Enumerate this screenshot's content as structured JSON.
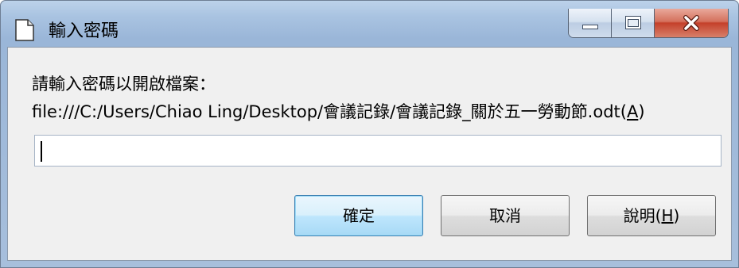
{
  "window": {
    "title": "輸入密碼",
    "icon": "document-icon",
    "controls": {
      "minimize_icon": "minimize-icon",
      "maximize_icon": "maximize-icon",
      "close_icon": "close-icon"
    }
  },
  "dialog": {
    "prompt": "請輸入密碼以開啟檔案：",
    "file_path": "file:///C:/Users/Chiao Ling/Desktop/會議記錄/會議記錄_關於五一勞動節.odt",
    "file_path_mnemonic_open": "(",
    "file_path_mnemonic_key": "A",
    "file_path_mnemonic_close": ")",
    "password_value": "",
    "password_placeholder": ""
  },
  "buttons": {
    "ok_label": "確定",
    "cancel_label": "取消",
    "help_label": "說明(",
    "help_mnemonic": "H",
    "help_label_end": ")"
  },
  "colors": {
    "frame_top": "#bcd2ea",
    "frame_bottom": "#a7bfdc",
    "client_bg": "#f0f0f0",
    "close_red": "#c4402a",
    "default_button_border": "#3c7fb1"
  }
}
